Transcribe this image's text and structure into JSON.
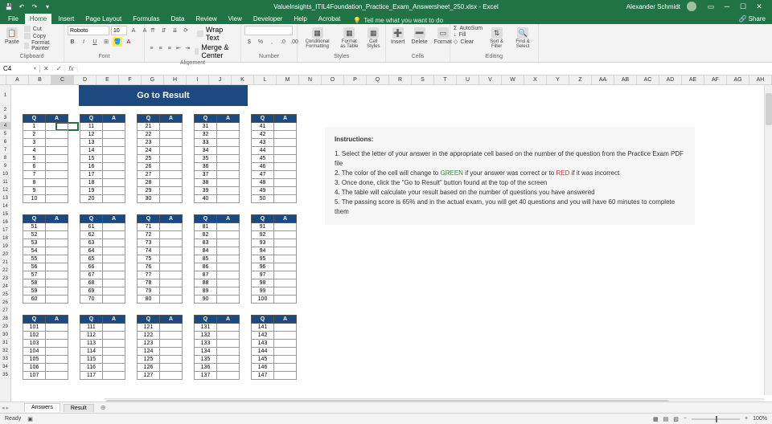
{
  "app": {
    "title": "ValueInsights_ITIL4Foundation_Practice_Exam_Answersheet_250.xlsx - Excel",
    "user": "Alexander Schmidt",
    "share": "Share"
  },
  "ribbon_tabs": [
    "File",
    "Home",
    "Insert",
    "Page Layout",
    "Formulas",
    "Data",
    "Review",
    "View",
    "Developer",
    "Help",
    "Acrobat"
  ],
  "active_tab": "Home",
  "tell_me": "Tell me what you want to do",
  "ribbon": {
    "clipboard": {
      "paste": "Paste",
      "cut": "Cut",
      "copy": "Copy",
      "painter": "Format Painter",
      "label": "Clipboard"
    },
    "font": {
      "name": "Roboto",
      "size": "10",
      "label": "Font"
    },
    "alignment": {
      "wrap": "Wrap Text",
      "merge": "Merge & Center",
      "label": "Alignment"
    },
    "number": {
      "label": "Number"
    },
    "styles": {
      "cond": "Conditional Formatting",
      "fmt_table": "Format as Table",
      "cell": "Cell Styles",
      "label": "Styles"
    },
    "cells": {
      "insert": "Insert",
      "delete": "Delete",
      "format": "Format",
      "label": "Cells"
    },
    "editing": {
      "autosum": "AutoSum",
      "fill": "Fill",
      "clear": "Clear",
      "sort": "Sort & Filter",
      "find": "Find & Select",
      "label": "Editing"
    }
  },
  "namebox": "C4",
  "columns": [
    "A",
    "B",
    "C",
    "D",
    "E",
    "F",
    "G",
    "H",
    "I",
    "J",
    "K",
    "L",
    "M",
    "N",
    "O",
    "P",
    "Q",
    "R",
    "S",
    "T",
    "U",
    "V",
    "W",
    "X",
    "Y",
    "Z",
    "AA",
    "AB",
    "AC",
    "AD",
    "AE",
    "AF",
    "AG",
    "AH"
  ],
  "selected_col": "C",
  "selected_row": 4,
  "go_result": "Go to Result",
  "qa": {
    "q": "Q",
    "a": "A"
  },
  "instructions": {
    "title": "Instructions:",
    "lines": [
      "1. Select the letter of your answer in the appropriate cell based on the number of the question from the Practice Exam PDF file",
      "2. The color of the cell will change to GREEN if your answer was correct or to RED if it was incorrect",
      "3. Once done, click the \"Go to Result\" button found at the top of the screen",
      "4. The table will calculate your result based on the number of questions you have answered",
      "5. The passing score is 65% and in the actual exam, you will get 40 questions and you will have 60 minutes to complete them"
    ]
  },
  "sheet_tabs": [
    "Answers",
    "Result"
  ],
  "active_sheet": "Answers",
  "status": {
    "ready": "Ready",
    "zoom": "100%"
  },
  "block_starts": [
    1,
    51,
    101
  ],
  "visible_rows_block3": 7
}
